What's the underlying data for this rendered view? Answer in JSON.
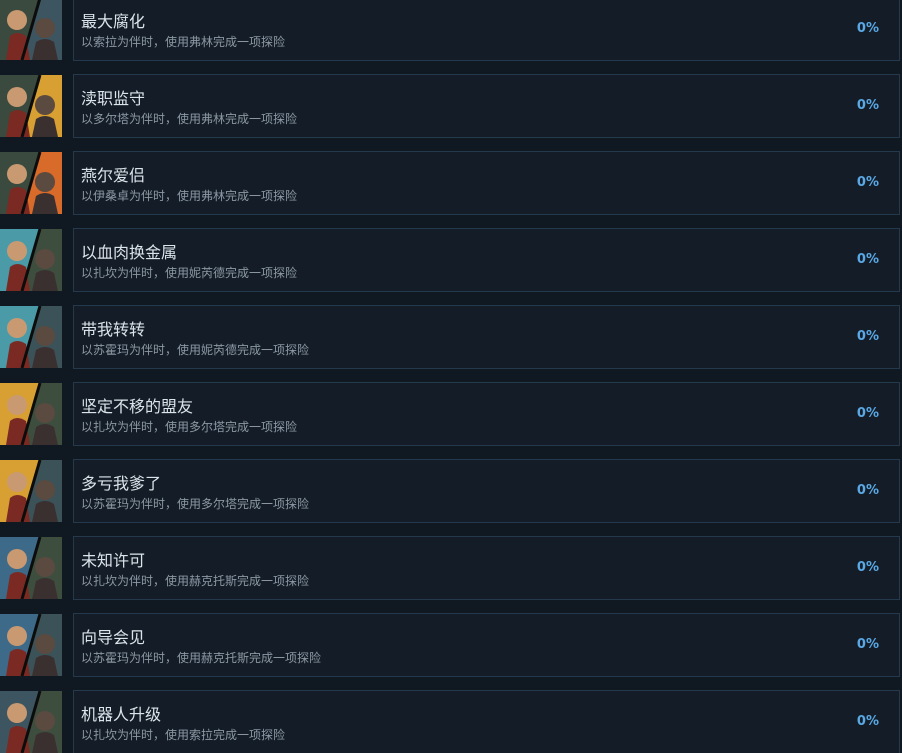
{
  "achievements": [
    {
      "title": "最大腐化",
      "desc": "以索拉为伴时，使用弗林完成一项探险",
      "percent": "0%",
      "left_bg": "#3a4a3e",
      "right_bg": "#3d5560",
      "icon_name": "flynn-sora-portrait-icon"
    },
    {
      "title": "渎职监守",
      "desc": "以多尔塔为伴时，使用弗林完成一项探险",
      "percent": "0%",
      "left_bg": "#3a4a3e",
      "right_bg": "#d8a032",
      "icon_name": "flynn-dorta-portrait-icon"
    },
    {
      "title": "燕尔爱侣",
      "desc": "以伊桑卓为伴时，使用弗林完成一项探险",
      "percent": "0%",
      "left_bg": "#3a4a3e",
      "right_bg": "#d86a2a",
      "icon_name": "flynn-isandra-portrait-icon"
    },
    {
      "title": "以血肉换金属",
      "desc": "以扎坎为伴时，使用妮芮德完成一项探险",
      "percent": "0%",
      "left_bg": "#4a9aa8",
      "right_bg": "#3e4e3e",
      "icon_name": "nerid-zakan-portrait-icon"
    },
    {
      "title": "带我转转",
      "desc": "以苏霍玛为伴时，使用妮芮德完成一项探险",
      "percent": "0%",
      "left_bg": "#4a9aa8",
      "right_bg": "#3a5258",
      "icon_name": "nerid-suhoma-portrait-icon"
    },
    {
      "title": "坚定不移的盟友",
      "desc": "以扎坎为伴时，使用多尔塔完成一项探险",
      "percent": "0%",
      "left_bg": "#d8a032",
      "right_bg": "#3e4e3e",
      "icon_name": "dorta-zakan-portrait-icon"
    },
    {
      "title": "多亏我爹了",
      "desc": "以苏霍玛为伴时，使用多尔塔完成一项探险",
      "percent": "0%",
      "left_bg": "#d8a032",
      "right_bg": "#3a5258",
      "icon_name": "dorta-suhoma-portrait-icon"
    },
    {
      "title": "未知许可",
      "desc": "以扎坎为伴时，使用赫克托斯完成一项探险",
      "percent": "0%",
      "left_bg": "#3e6a8a",
      "right_bg": "#3e4e3e",
      "icon_name": "hektos-zakan-portrait-icon"
    },
    {
      "title": "向导会见",
      "desc": "以苏霍玛为伴时，使用赫克托斯完成一项探险",
      "percent": "0%",
      "left_bg": "#3e6a8a",
      "right_bg": "#3a5258",
      "icon_name": "hektos-suhoma-portrait-icon"
    },
    {
      "title": "机器人升级",
      "desc": "以扎坎为伴时，使用索拉完成一项探险",
      "percent": "0%",
      "left_bg": "#3d5560",
      "right_bg": "#3e4e3e",
      "icon_name": "sora-zakan-portrait-icon"
    }
  ]
}
